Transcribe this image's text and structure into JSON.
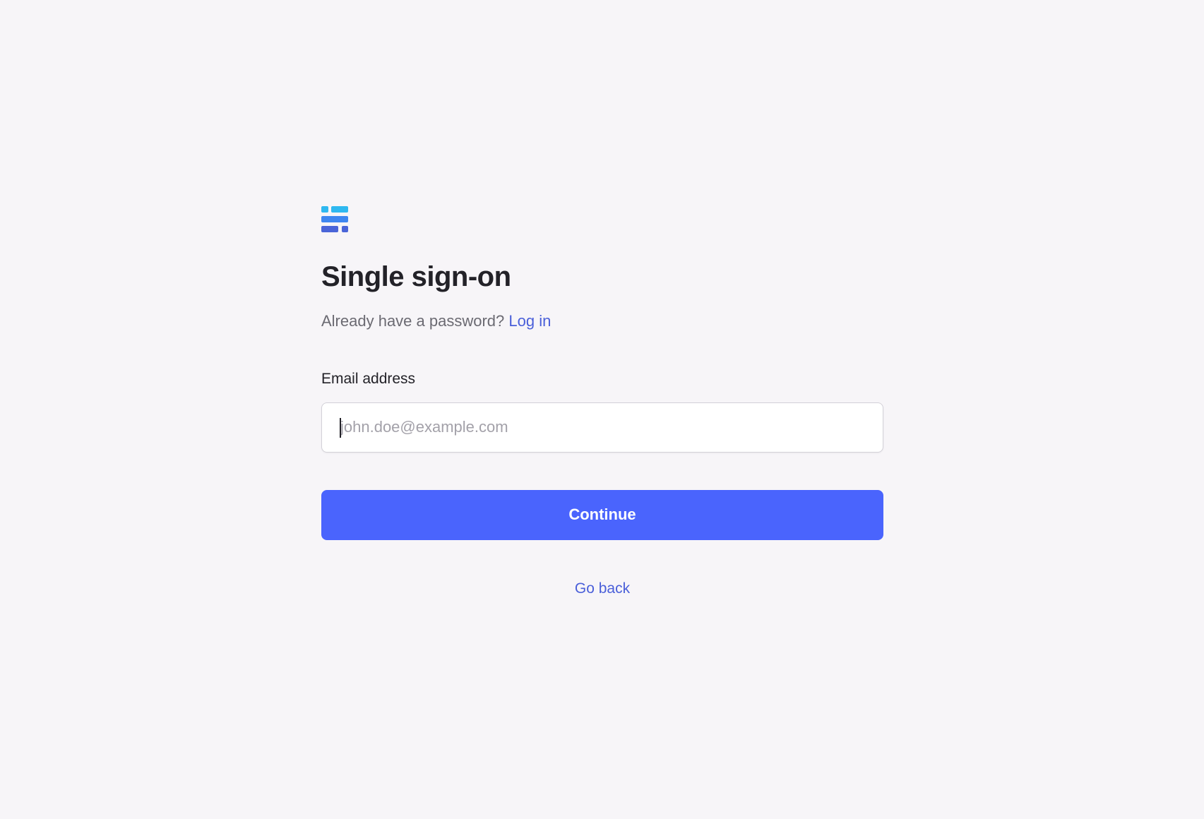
{
  "logo": {
    "icon": "stacked-bars-logo-icon",
    "colors": [
      "#2fb8f0",
      "#3e86f0",
      "#4a64d8"
    ]
  },
  "title": "Single sign-on",
  "subtitle": {
    "text": "Already have a password? ",
    "link_label": "Log in"
  },
  "email": {
    "label": "Email address",
    "placeholder": "john.doe@example.com",
    "value": ""
  },
  "continue_label": "Continue",
  "go_back_label": "Go back",
  "colors": {
    "background": "#f7f5f8",
    "accent": "#4a64fd",
    "link": "#4a5fd9",
    "heading": "#232228"
  }
}
